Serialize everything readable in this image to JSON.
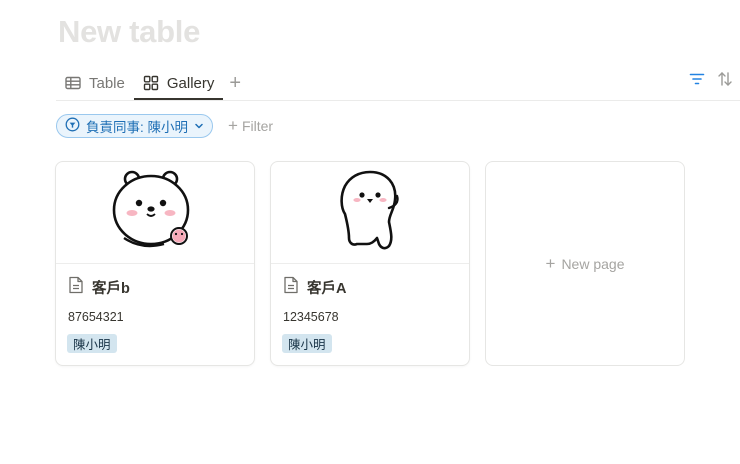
{
  "page": {
    "title": "New table"
  },
  "views": {
    "tabs": [
      {
        "label": "Table",
        "icon": "table-icon",
        "active": false
      },
      {
        "label": "Gallery",
        "icon": "gallery-icon",
        "active": true
      }
    ],
    "add_icon": "plus-icon"
  },
  "toolbar": {
    "filter_icon": "filter-icon",
    "sort_icon": "sort-icon",
    "accent_color": "#2383e2"
  },
  "filter": {
    "chip_label": "負責同事: 陳小明",
    "add_label": "Filter"
  },
  "cards": [
    {
      "name": "客戶b",
      "phone": "87654321",
      "tag": "陳小明",
      "cover": "bear-sticker",
      "doc_icon": "page-icon"
    },
    {
      "name": "客戶A",
      "phone": "12345678",
      "tag": "陳小明",
      "cover": "blob-sticker",
      "doc_icon": "page-icon"
    }
  ],
  "new_page": {
    "label": "New page"
  },
  "colors": {
    "tag_bg": "#d3e5ef",
    "chip_bg": "#eaf4fc",
    "chip_text": "#1f6fb5",
    "title_placeholder": "#e3e2e0"
  }
}
